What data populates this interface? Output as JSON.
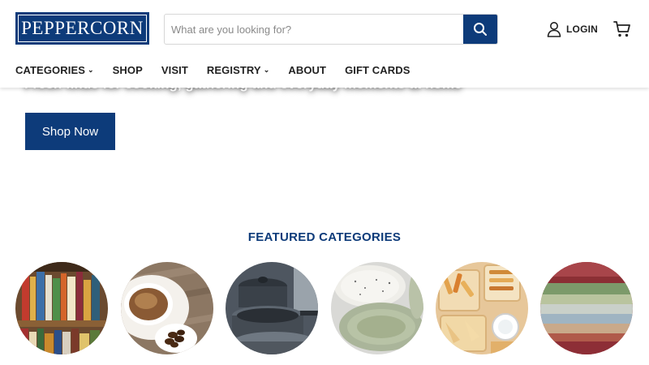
{
  "header": {
    "logo_text": "PEPPERCORN",
    "search": {
      "placeholder": "What are you looking for?",
      "value": ""
    },
    "search_icon": "search-icon",
    "login_label": "LOGIN",
    "login_icon": "user-icon",
    "cart_icon": "cart-icon"
  },
  "nav": {
    "items": [
      {
        "label": "CATEGORIES",
        "chevron": "⌄"
      },
      {
        "label": "SHOP"
      },
      {
        "label": "VISIT"
      },
      {
        "label": "REGISTRY",
        "chevron": "⌄"
      },
      {
        "label": "ABOUT"
      },
      {
        "label": "GIFT CARDS"
      }
    ]
  },
  "hero": {
    "subtitle": "Fresh finds for cooking, gathering and everyday moments at home",
    "cta_label": "Shop Now"
  },
  "featured": {
    "title": "FEATURED CATEGORIES",
    "categories": [
      {
        "image": "books"
      },
      {
        "image": "coffee"
      },
      {
        "image": "cookware"
      },
      {
        "image": "ceramic-plates"
      },
      {
        "image": "pasta"
      },
      {
        "image": "striped-linens"
      }
    ]
  },
  "colors": {
    "brand_navy": "#0d3b7a",
    "text_dark": "#222222",
    "background": "#ffffff"
  }
}
